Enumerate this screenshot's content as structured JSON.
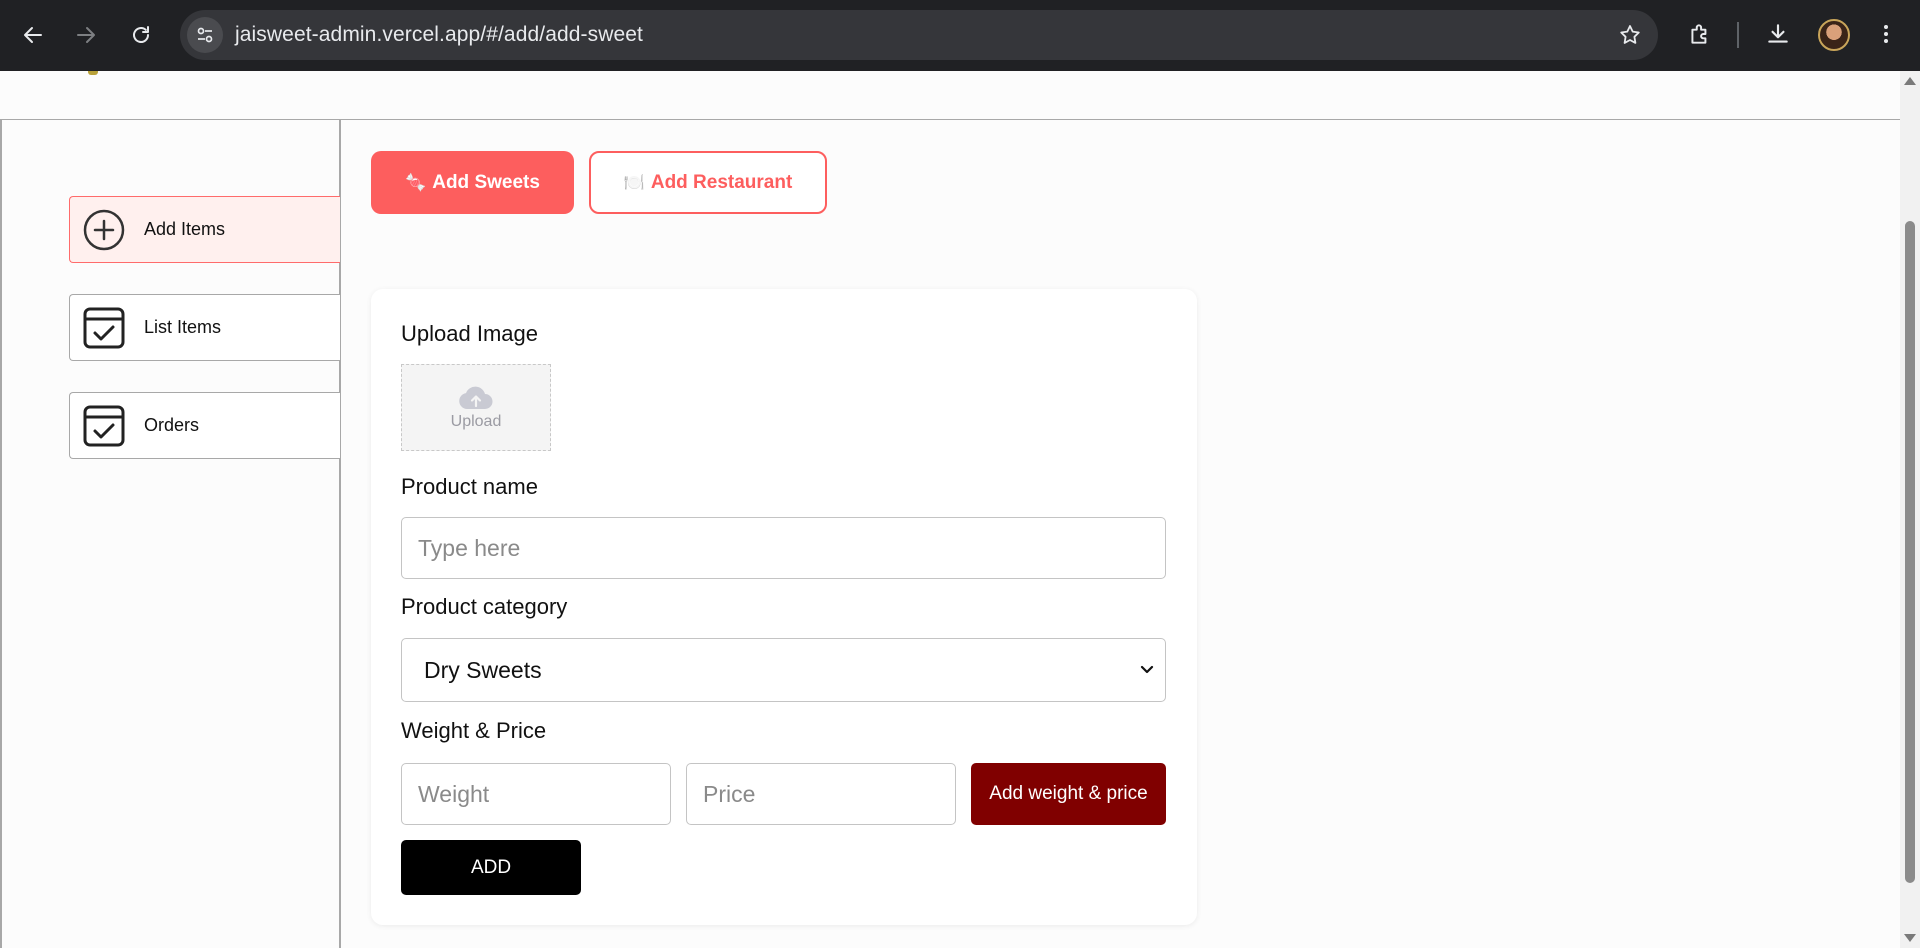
{
  "browser": {
    "url": "jaisweet-admin.vercel.app/#/add/add-sweet"
  },
  "sidebar": {
    "items": [
      {
        "label": "Add Items",
        "icon": "plus-circle-icon",
        "active": true
      },
      {
        "label": "List Items",
        "icon": "calendar-check-icon",
        "active": false
      },
      {
        "label": "Orders",
        "icon": "calendar-check-icon",
        "active": false
      }
    ]
  },
  "tabs": {
    "sweets_label": "Add Sweets",
    "sweets_icon": "🍬",
    "restaurant_label": "Add Restaurant",
    "restaurant_icon": "🍽️"
  },
  "form": {
    "upload_label": "Upload Image",
    "upload_text": "Upload",
    "product_name_label": "Product name",
    "product_name_placeholder": "Type here",
    "product_category_label": "Product category",
    "product_category_value": "Dry Sweets",
    "weight_price_label": "Weight & Price",
    "weight_placeholder": "Weight",
    "price_placeholder": "Price",
    "add_weight_price_label": "Add weight & price",
    "add_label": "ADD"
  },
  "colors": {
    "accent": "#fd5e5e",
    "maroon": "#800000",
    "active_bg": "#fff0ee"
  }
}
